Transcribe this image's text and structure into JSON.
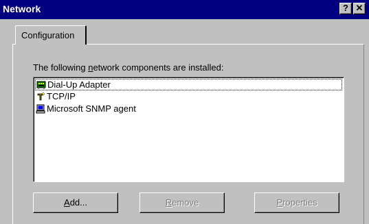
{
  "window": {
    "title": "Network",
    "help_label": "?",
    "close_label": "✕"
  },
  "tabs": [
    {
      "label": "Configuration",
      "active": true
    }
  ],
  "instruction": {
    "before": "The following ",
    "accel": "n",
    "after": "etwork components are installed:"
  },
  "components": [
    {
      "label": "Dial-Up Adapter",
      "icon": "network-adapter-icon",
      "selected": true
    },
    {
      "label": "TCP/IP",
      "icon": "protocol-icon",
      "selected": false
    },
    {
      "label": "Microsoft SNMP agent",
      "icon": "service-icon",
      "selected": false
    }
  ],
  "buttons": {
    "add": {
      "accel": "A",
      "rest": "dd...",
      "enabled": true
    },
    "remove": {
      "accel": "R",
      "rest": "emove",
      "enabled": false
    },
    "properties": {
      "accel": "P",
      "rest": "roperties",
      "enabled": false
    }
  },
  "colors": {
    "titlebar": "#000080",
    "face": "#c0c0c0",
    "disabled_text": "#808080"
  }
}
